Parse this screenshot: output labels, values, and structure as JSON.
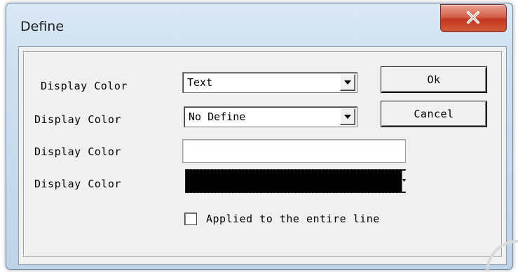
{
  "window": {
    "title": "Define",
    "close_glyph": "close-icon"
  },
  "rows": [
    {
      "label": "Display Color",
      "control": "combo",
      "value": "Text"
    },
    {
      "label": "Display Color",
      "control": "combo",
      "value": "No Define"
    },
    {
      "label": "Display Color",
      "control": "text",
      "value": ""
    },
    {
      "label": "Display Color",
      "control": "color",
      "color": "#000000"
    }
  ],
  "buttons": {
    "ok": "Ok",
    "cancel": "Cancel"
  },
  "checkbox": {
    "label": "Applied to the entire line",
    "checked": false
  },
  "colors": {
    "close_button": "#c8442a",
    "frame": "#cfe0f1",
    "client": "#f0f0f0"
  }
}
